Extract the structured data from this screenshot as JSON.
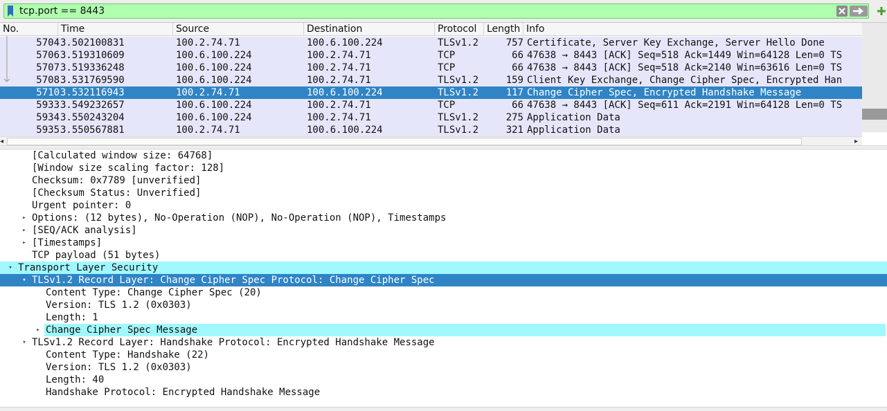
{
  "filter": {
    "value": "tcp.port == 8443"
  },
  "packet_list": {
    "columns": [
      "No.",
      "Time",
      "Source",
      "Destination",
      "Protocol",
      "Length",
      "Info"
    ],
    "rows": [
      {
        "no": "5704",
        "time": "3.502100831",
        "src": "100.2.74.71",
        "dst": "100.6.100.224",
        "proto": "TLSv1.2",
        "len": "757",
        "info": "Certificate, Server Key Exchange, Server Hello Done"
      },
      {
        "no": "5706",
        "time": "3.519310609",
        "src": "100.6.100.224",
        "dst": "100.2.74.71",
        "proto": "TCP",
        "len": "66",
        "info": "47638 → 8443 [ACK] Seq=518 Ack=1449 Win=64128 Len=0 TS"
      },
      {
        "no": "5707",
        "time": "3.519336248",
        "src": "100.6.100.224",
        "dst": "100.2.74.71",
        "proto": "TCP",
        "len": "66",
        "info": "47638 → 8443 [ACK] Seq=518 Ack=2140 Win=63616 Len=0 TS"
      },
      {
        "no": "5708",
        "time": "3.531769590",
        "src": "100.6.100.224",
        "dst": "100.2.74.71",
        "proto": "TLSv1.2",
        "len": "159",
        "info": "Client Key Exchange, Change Cipher Spec, Encrypted Han"
      },
      {
        "no": "5710",
        "time": "3.532116943",
        "src": "100.2.74.71",
        "dst": "100.6.100.224",
        "proto": "TLSv1.2",
        "len": "117",
        "info": "Change Cipher Spec, Encrypted Handshake Message"
      },
      {
        "no": "5933",
        "time": "3.549232657",
        "src": "100.6.100.224",
        "dst": "100.2.74.71",
        "proto": "TCP",
        "len": "66",
        "info": "47638 → 8443 [ACK] Seq=611 Ack=2191 Win=64128 Len=0 TS"
      },
      {
        "no": "5934",
        "time": "3.550243204",
        "src": "100.6.100.224",
        "dst": "100.2.74.71",
        "proto": "TLSv1.2",
        "len": "275",
        "info": "Application Data"
      },
      {
        "no": "5935",
        "time": "3.550567881",
        "src": "100.2.74.71",
        "dst": "100.6.100.224",
        "proto": "TLSv1.2",
        "len": "321",
        "info": "Application Data"
      }
    ],
    "selected_no": "5710"
  },
  "details": [
    {
      "text": "[Calculated window size: 64768]",
      "expander": "none",
      "level": 2,
      "style": "normal"
    },
    {
      "text": "[Window size scaling factor: 128]",
      "expander": "none",
      "level": 2,
      "style": "normal"
    },
    {
      "text": "Checksum: 0x7789 [unverified]",
      "expander": "none",
      "level": 2,
      "style": "normal"
    },
    {
      "text": "[Checksum Status: Unverified]",
      "expander": "none",
      "level": 2,
      "style": "normal"
    },
    {
      "text": "Urgent pointer: 0",
      "expander": "none",
      "level": 2,
      "style": "normal"
    },
    {
      "text": "Options: (12 bytes), No-Operation (NOP), No-Operation (NOP), Timestamps",
      "expander": "collapsed",
      "level": 2,
      "style": "normal"
    },
    {
      "text": "[SEQ/ACK analysis]",
      "expander": "collapsed",
      "level": 2,
      "style": "normal"
    },
    {
      "text": "[Timestamps]",
      "expander": "collapsed",
      "level": 2,
      "style": "normal"
    },
    {
      "text": "TCP payload (51 bytes)",
      "expander": "none",
      "level": 2,
      "style": "normal"
    },
    {
      "text": "Transport Layer Security",
      "expander": "expanded",
      "level": 1,
      "style": "highlight-full"
    },
    {
      "text": "TLSv1.2 Record Layer: Change Cipher Spec Protocol: Change Cipher Spec",
      "expander": "expanded",
      "level": 2,
      "style": "selected"
    },
    {
      "text": "Content Type: Change Cipher Spec (20)",
      "expander": "none",
      "level": 3,
      "style": "normal"
    },
    {
      "text": "Version: TLS 1.2 (0x0303)",
      "expander": "none",
      "level": 3,
      "style": "normal"
    },
    {
      "text": "Length: 1",
      "expander": "none",
      "level": 3,
      "style": "normal"
    },
    {
      "text": "Change Cipher Spec Message",
      "expander": "collapsed",
      "level": 3,
      "style": "highlight-full"
    },
    {
      "text": "TLSv1.2 Record Layer: Handshake Protocol: Encrypted Handshake Message",
      "expander": "expanded",
      "level": 2,
      "style": "normal"
    },
    {
      "text": "Content Type: Handshake (22)",
      "expander": "none",
      "level": 3,
      "style": "normal"
    },
    {
      "text": "Version: TLS 1.2 (0x0303)",
      "expander": "none",
      "level": 3,
      "style": "normal"
    },
    {
      "text": "Length: 40",
      "expander": "none",
      "level": 3,
      "style": "normal"
    },
    {
      "text": "Handshake Protocol: Encrypted Handshake Message",
      "expander": "none",
      "level": 3,
      "style": "normal"
    }
  ],
  "colors": {
    "filter_valid": "#afffaf",
    "row_tls_bg": "#e6e6fa",
    "selected": "#2f84c5",
    "field_highlight": "#a0f8fc"
  },
  "icons": {
    "bookmark": "bookmark-icon",
    "clear": "clear-icon",
    "apply": "arrow-right-icon",
    "add": "plus-icon"
  }
}
